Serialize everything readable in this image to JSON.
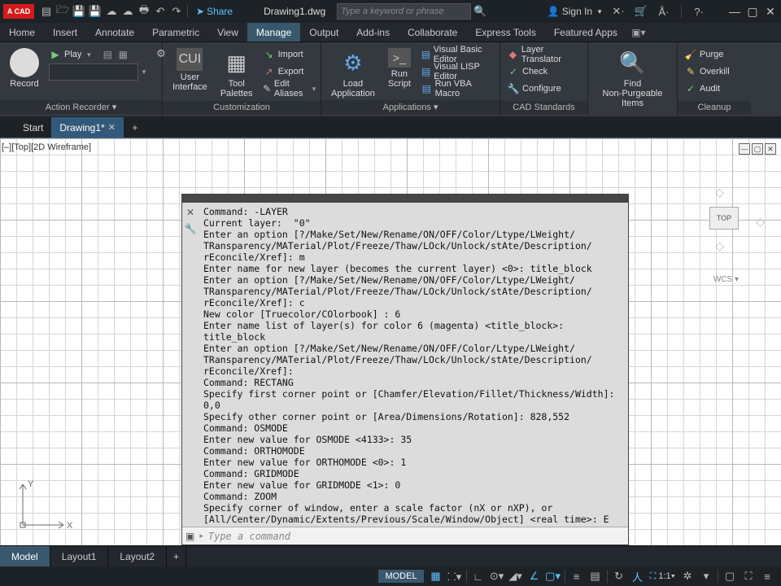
{
  "titlebar": {
    "app_logo": "A CAD",
    "share": "Share",
    "filename": "Drawing1.dwg",
    "search_placeholder": "Type a keyword or phrase",
    "signin": "Sign In"
  },
  "menu": {
    "tabs": [
      "Home",
      "Insert",
      "Annotate",
      "Parametric",
      "View",
      "Manage",
      "Output",
      "Add-ins",
      "Collaborate",
      "Express Tools",
      "Featured Apps"
    ],
    "active": "Manage"
  },
  "ribbon": {
    "action_recorder": {
      "record": "Record",
      "play": "Play",
      "panel": "Action Recorder"
    },
    "customization": {
      "ui": "User\nInterface",
      "palettes": "Tool\nPalettes",
      "import": "Import",
      "export": "Export",
      "aliases": "Edit Aliases",
      "panel": "Customization"
    },
    "applications": {
      "load": "Load\nApplication",
      "run": "Run\nScript",
      "vbe": "Visual Basic Editor",
      "vle": "Visual LISP Editor",
      "vba": "Run VBA Macro",
      "panel": "Applications"
    },
    "cad": {
      "layer": "Layer Translator",
      "check": "Check",
      "config": "Configure",
      "panel": "CAD Standards"
    },
    "find": {
      "find": "Find\nNon-Purgeable Items"
    },
    "cleanup": {
      "purge": "Purge",
      "overkill": "Overkill",
      "audit": "Audit",
      "panel": "Cleanup"
    }
  },
  "doctabs": {
    "start": "Start",
    "current": "Drawing1*"
  },
  "viewport": {
    "label": "[–][Top][2D Wireframe]",
    "cube": "TOP",
    "wcs": "WCS"
  },
  "axes": {
    "y": "Y",
    "x": "X"
  },
  "cmd": {
    "lines": [
      "Command: -LAYER",
      "Current layer:  \"0\"",
      "Enter an option [?/Make/Set/New/Rename/ON/OFF/Color/Ltype/LWeight/",
      "TRansparency/MATerial/Plot/Freeze/Thaw/LOck/Unlock/stAte/Description/",
      "rEconcile/Xref]: m",
      "Enter name for new layer (becomes the current layer) <0>: title_block",
      "Enter an option [?/Make/Set/New/Rename/ON/OFF/Color/Ltype/LWeight/",
      "TRansparency/MATerial/Plot/Freeze/Thaw/LOck/Unlock/stAte/Description/",
      "rEconcile/Xref]: c",
      "New color [Truecolor/COlorbook] : 6",
      "Enter name list of layer(s) for color 6 (magenta) <title_block>: title_block",
      "Enter an option [?/Make/Set/New/Rename/ON/OFF/Color/Ltype/LWeight/",
      "TRansparency/MATerial/Plot/Freeze/Thaw/LOck/Unlock/stAte/Description/",
      "rEconcile/Xref]:",
      "Command: RECTANG",
      "Specify first corner point or [Chamfer/Elevation/Fillet/Thickness/Width]: 0,0",
      "Specify other corner point or [Area/Dimensions/Rotation]: 828,552",
      "Command: OSMODE",
      "Enter new value for OSMODE <4133>: 35",
      "Command: ORTHOMODE",
      "Enter new value for ORTHOMODE <0>: 1",
      "Command: GRIDMODE",
      "Enter new value for GRIDMODE <1>: 0",
      "Command: ZOOM",
      "Specify corner of window, enter a scale factor (nX or nXP), or",
      "[All/Center/Dynamic/Extents/Previous/Scale/Window/Object] <real time>: E"
    ],
    "placeholder": "Type a command"
  },
  "layouts": {
    "model": "Model",
    "l1": "Layout1",
    "l2": "Layout2"
  },
  "status": {
    "model": "MODEL",
    "scale": "1:1"
  }
}
